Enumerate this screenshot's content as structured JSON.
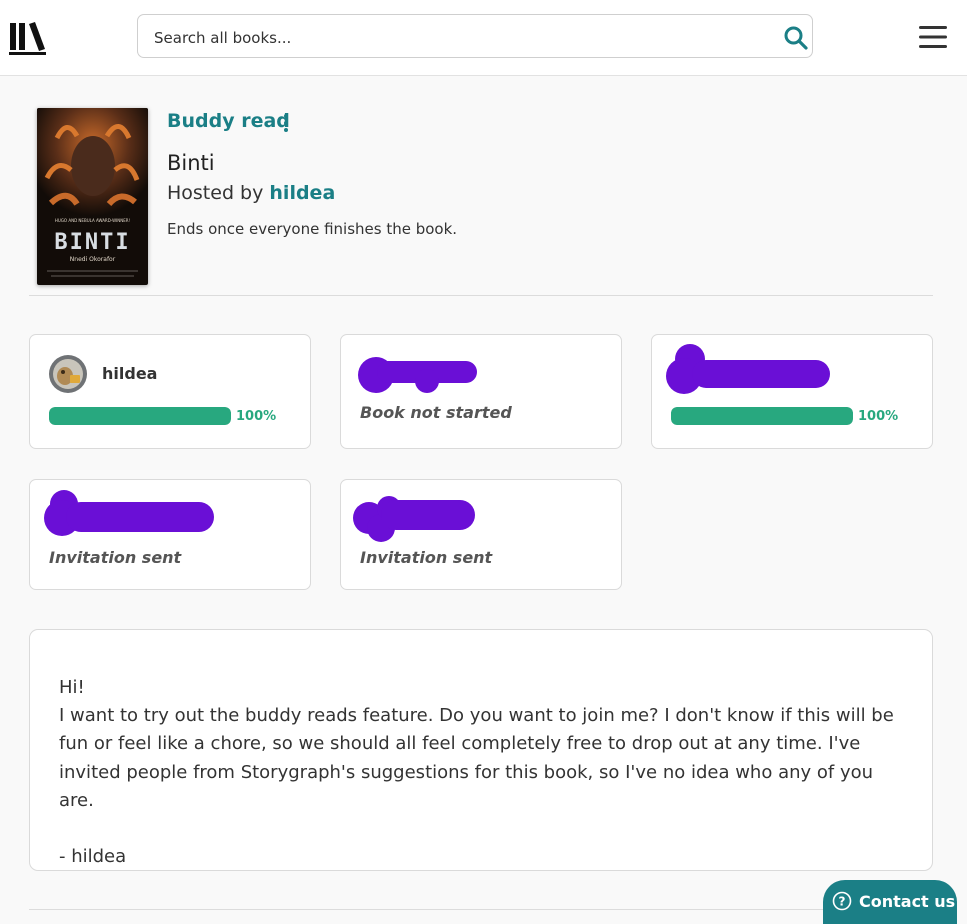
{
  "header": {
    "logo_icon": "bookshelf-logo-icon",
    "search": {
      "placeholder": "Search all books...",
      "value": "",
      "icon": "search-icon"
    },
    "menu_icon": "hamburger-menu-icon"
  },
  "buddy_read": {
    "label": "Buddy read",
    "options_icon": "kebab-menu-icon",
    "book_title": "Binti",
    "hosted_by_prefix": "Hosted by ",
    "host": "hildea",
    "ends_text": "Ends once everyone finishes the book.",
    "cover": {
      "award_line": "HUGO AND NEBULA AWARD-WINNER!",
      "title": "BINTI",
      "author": "Nnedi Okorafor"
    }
  },
  "participants": [
    {
      "name": "hildea",
      "progress_percent": 100,
      "progress_label": "100%",
      "status": ""
    },
    {
      "name": "",
      "progress_percent": null,
      "progress_label": "",
      "status": "Book not started"
    },
    {
      "name": "",
      "progress_percent": 100,
      "progress_label": "100%",
      "status": ""
    },
    {
      "name": "",
      "progress_percent": null,
      "progress_label": "",
      "status": "Invitation sent"
    },
    {
      "name": "",
      "progress_percent": null,
      "progress_label": "",
      "status": "Invitation sent"
    }
  ],
  "message": {
    "text": "Hi!\nI want to try out the buddy reads feature. Do you want to join me? I don't know if this will be fun or feel like a chore, so we should all feel completely free to drop out at any time. I've invited people from Storygraph's suggestions for this book, so I've no idea who any of you are.\n\n- hildea"
  },
  "contact": {
    "label": "Contact us",
    "icon": "help-circle-icon"
  },
  "colors": {
    "accent": "#1b7f86",
    "progress": "#28a87f",
    "redaction": "#6a0fd6",
    "background": "#f9f9f9"
  }
}
